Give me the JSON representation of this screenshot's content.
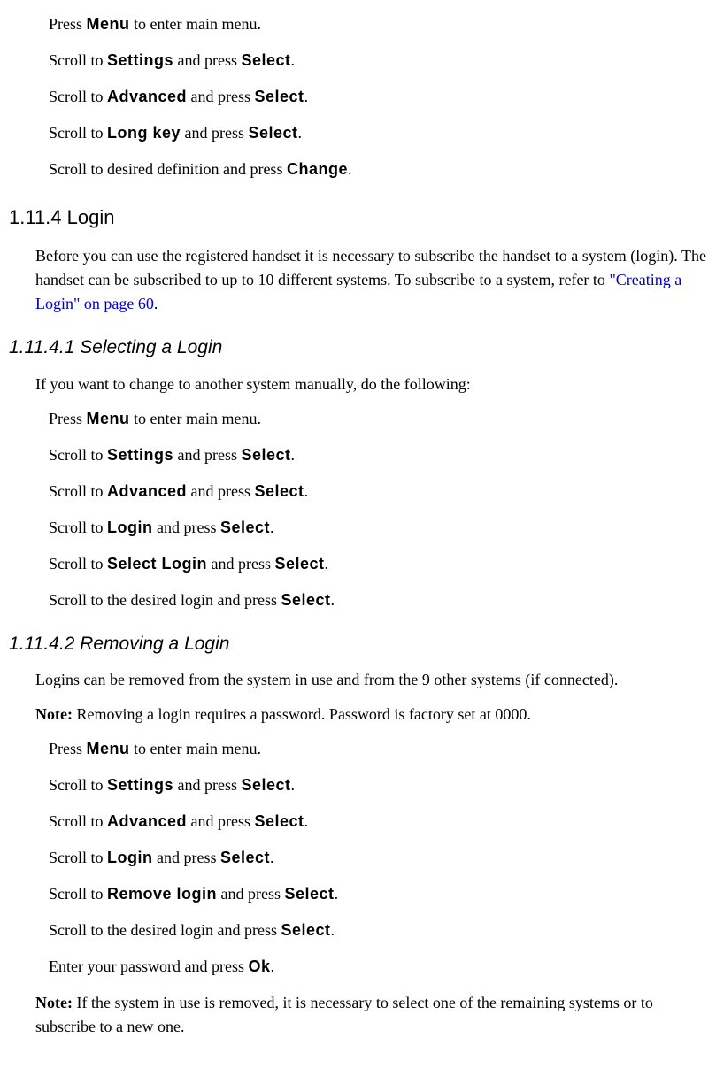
{
  "section_a": {
    "steps": [
      {
        "prefix": "Press",
        "key": "Menu",
        "suffix": " to enter main menu."
      },
      {
        "prefix": "Scroll to",
        "key": "Settings",
        "mid": " and press",
        "key2": "Select",
        "suffix": "."
      },
      {
        "prefix": "Scroll to",
        "key": "Advanced",
        "mid": " and press",
        "key2": "Select",
        "suffix": "."
      },
      {
        "prefix": "Scroll to",
        "key": "Long key",
        "mid": " and press",
        "key2": "Select",
        "suffix": "."
      },
      {
        "prefix": "Scroll to desired definition and press",
        "key": "Change",
        "suffix": "."
      }
    ]
  },
  "login_heading": "1.11.4  Login",
  "login_para_1": "Before you can use the registered handset it is necessary to subscribe the handset to a system (login). The handset can be subscribed to up to 10 different systems. To subscribe to a system, refer to ",
  "login_link": "\"Creating a Login\" on page 60",
  "login_para_1_end": ".",
  "selecting_heading": "1.11.4.1  Selecting a Login",
  "selecting_intro": "If you want to change to another system manually, do the following:",
  "selecting_steps": [
    {
      "prefix": "Press",
      "key": "Menu",
      "suffix": " to enter main menu."
    },
    {
      "prefix": "Scroll to",
      "key": "Settings",
      "mid": " and press",
      "key2": "Select",
      "suffix": "."
    },
    {
      "prefix": "Scroll to",
      "key": "Advanced",
      "mid": " and press",
      "key2": "Select",
      "suffix": "."
    },
    {
      "prefix": "Scroll to",
      "key": "Login",
      "mid": " and press",
      "key2": "Select",
      "suffix": "."
    },
    {
      "prefix": "Scroll to",
      "key": "Select Login",
      "mid": " and press",
      "key2": "Select",
      "suffix": "."
    },
    {
      "prefix": "Scroll to the desired login and press",
      "key": "Select",
      "suffix": "."
    }
  ],
  "removing_heading": "1.11.4.2  Removing a Login",
  "removing_intro": "Logins can be removed from the system in use and from the 9 other systems (if connected).",
  "removing_note_label": "Note:",
  "removing_note_text": " Removing a login requires a password. Password is factory set at 0000.",
  "removing_steps": [
    {
      "prefix": "Press",
      "key": "Menu",
      "suffix": " to enter main menu."
    },
    {
      "prefix": "Scroll to",
      "key": "Settings",
      "mid": " and press",
      "key2": "Select",
      "suffix": "."
    },
    {
      "prefix": "Scroll to",
      "key": "Advanced",
      "mid": " and press",
      "key2": "Select",
      "suffix": "."
    },
    {
      "prefix": "Scroll to",
      "key": "Login",
      "mid": " and press",
      "key2": "Select",
      "suffix": "."
    },
    {
      "prefix": "Scroll to",
      "key": "Remove login",
      "mid": " and press",
      "key2": "Select",
      "suffix": "."
    },
    {
      "prefix": "Scroll to the desired login and press",
      "key": "Select",
      "suffix": "."
    },
    {
      "prefix": "Enter your password and press",
      "key": "Ok",
      "suffix": "."
    }
  ],
  "removing_note2_label": "Note:",
  "removing_note2_text": " If the system in use is removed, it is necessary to select one of the remaining systems or to subscribe to a new one."
}
